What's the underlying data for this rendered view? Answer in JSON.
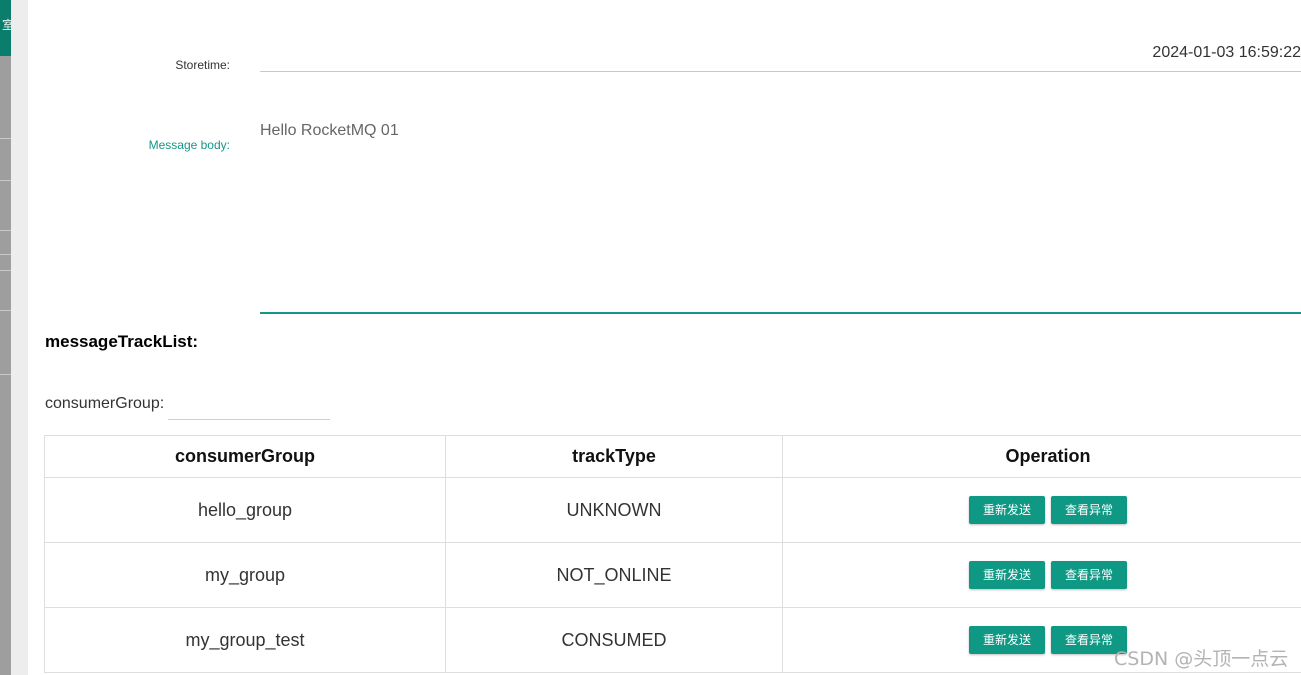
{
  "sidebar": {
    "tab_glyph": "室"
  },
  "message": {
    "storetime_label": "Storetime:",
    "storetime_value": "2024-01-03 16:59:22",
    "body_label": "Message body:",
    "body_value": "Hello RocketMQ 01"
  },
  "track": {
    "title": "messageTrackList:",
    "filter_label": "consumerGroup:",
    "filter_value": "",
    "headers": [
      "consumerGroup",
      "trackType",
      "Operation"
    ],
    "rows": [
      {
        "consumerGroup": "hello_group",
        "trackType": "UNKNOWN"
      },
      {
        "consumerGroup": "my_group",
        "trackType": "NOT_ONLINE"
      },
      {
        "consumerGroup": "my_group_test",
        "trackType": "CONSUMED"
      }
    ],
    "resend_label": "重新发送",
    "view_exception_label": "查看异常"
  },
  "watermark": "CSDN @头顶一点云",
  "colors": {
    "accent": "#0f9985",
    "label_accent": "#159688"
  }
}
